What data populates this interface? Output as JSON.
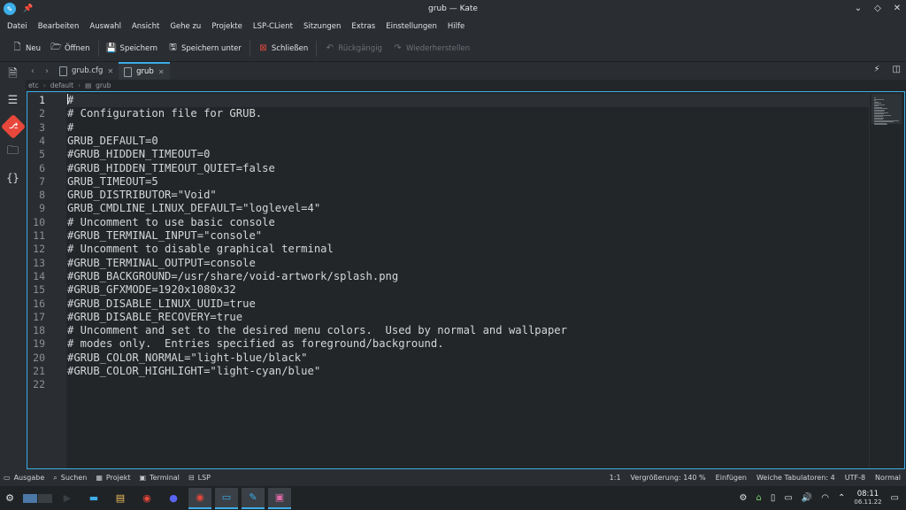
{
  "window": {
    "title": "grub — Kate",
    "controls": {
      "minimize": "⌄",
      "maximize": "◇",
      "close": "✕"
    }
  },
  "menubar": [
    "Datei",
    "Bearbeiten",
    "Auswahl",
    "Ansicht",
    "Gehe zu",
    "Projekte",
    "LSP-CLient",
    "Sitzungen",
    "Extras",
    "Einstellungen",
    "Hilfe"
  ],
  "toolbar": {
    "new": "Neu",
    "open": "Öffnen",
    "save": "Speichern",
    "save_as": "Speichern unter",
    "close": "Schließen",
    "undo": "Rückgängig",
    "redo": "Wiederherstellen"
  },
  "sidebar": {
    "icons": [
      "document-icon",
      "list-icon",
      "git-icon",
      "folder-icon",
      "symbols-icon"
    ]
  },
  "tabs": [
    {
      "label": "grub.cfg",
      "active": false
    },
    {
      "label": "grub",
      "active": true
    }
  ],
  "breadcrumb": [
    "etc",
    "default",
    "grub"
  ],
  "editor": {
    "current_line": 1,
    "lines": [
      "#",
      "# Configuration file for GRUB.",
      "#",
      "GRUB_DEFAULT=0",
      "#GRUB_HIDDEN_TIMEOUT=0",
      "#GRUB_HIDDEN_TIMEOUT_QUIET=false",
      "GRUB_TIMEOUT=5",
      "GRUB_DISTRIBUTOR=\"Void\"",
      "GRUB_CMDLINE_LINUX_DEFAULT=\"loglevel=4\"",
      "# Uncomment to use basic console",
      "#GRUB_TERMINAL_INPUT=\"console\"",
      "# Uncomment to disable graphical terminal",
      "#GRUB_TERMINAL_OUTPUT=console",
      "#GRUB_BACKGROUND=/usr/share/void-artwork/splash.png",
      "#GRUB_GFXMODE=1920x1080x32",
      "#GRUB_DISABLE_LINUX_UUID=true",
      "#GRUB_DISABLE_RECOVERY=true",
      "# Uncomment and set to the desired menu colors.  Used by normal and wallpaper",
      "# modes only.  Entries specified as foreground/background.",
      "#GRUB_COLOR_NORMAL=\"light-blue/black\"",
      "#GRUB_COLOR_HIGHLIGHT=\"light-cyan/blue\"",
      ""
    ]
  },
  "statusbar": {
    "left": [
      "Ausgabe",
      "Suchen",
      "Projekt",
      "Terminal",
      "LSP"
    ],
    "cursor": "1:1",
    "zoom": "Vergrößerung: 140 %",
    "mode_insert": "Einfügen",
    "tabs": "Weiche Tabulatoren: 4",
    "encoding": "UTF-8",
    "input_mode": "Normal"
  },
  "taskbar": {
    "time": "08:11",
    "date": "06.11.22"
  },
  "colors": {
    "accent": "#3daee9",
    "background": "#232629",
    "panel": "#2a2e32"
  }
}
